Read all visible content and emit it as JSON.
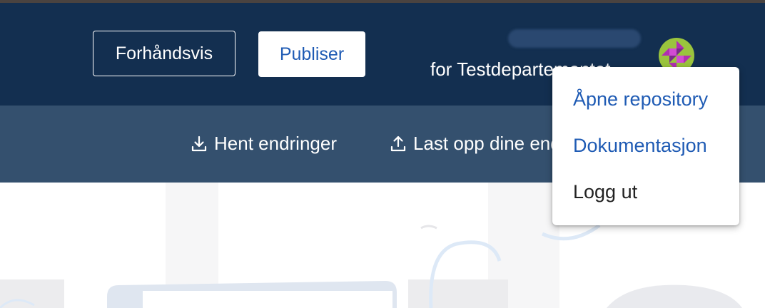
{
  "header": {
    "preview_label": "Forhåndsvis",
    "publish_label": "Publiser",
    "org_text": "for Testdepartementet"
  },
  "subbar": {
    "fetch_label": "Hent endringer",
    "upload_label": "Last opp dine endringer"
  },
  "menu": {
    "items": [
      {
        "label": "Åpne repository"
      },
      {
        "label": "Dokumentasjon"
      },
      {
        "label": "Logg ut"
      }
    ]
  },
  "icons": {
    "download": "download-icon",
    "upload": "upload-icon",
    "avatar": "avatar-icon"
  },
  "colors": {
    "header_bg": "#132f50",
    "subbar_bg": "#34506e",
    "link": "#1f5bb4"
  }
}
